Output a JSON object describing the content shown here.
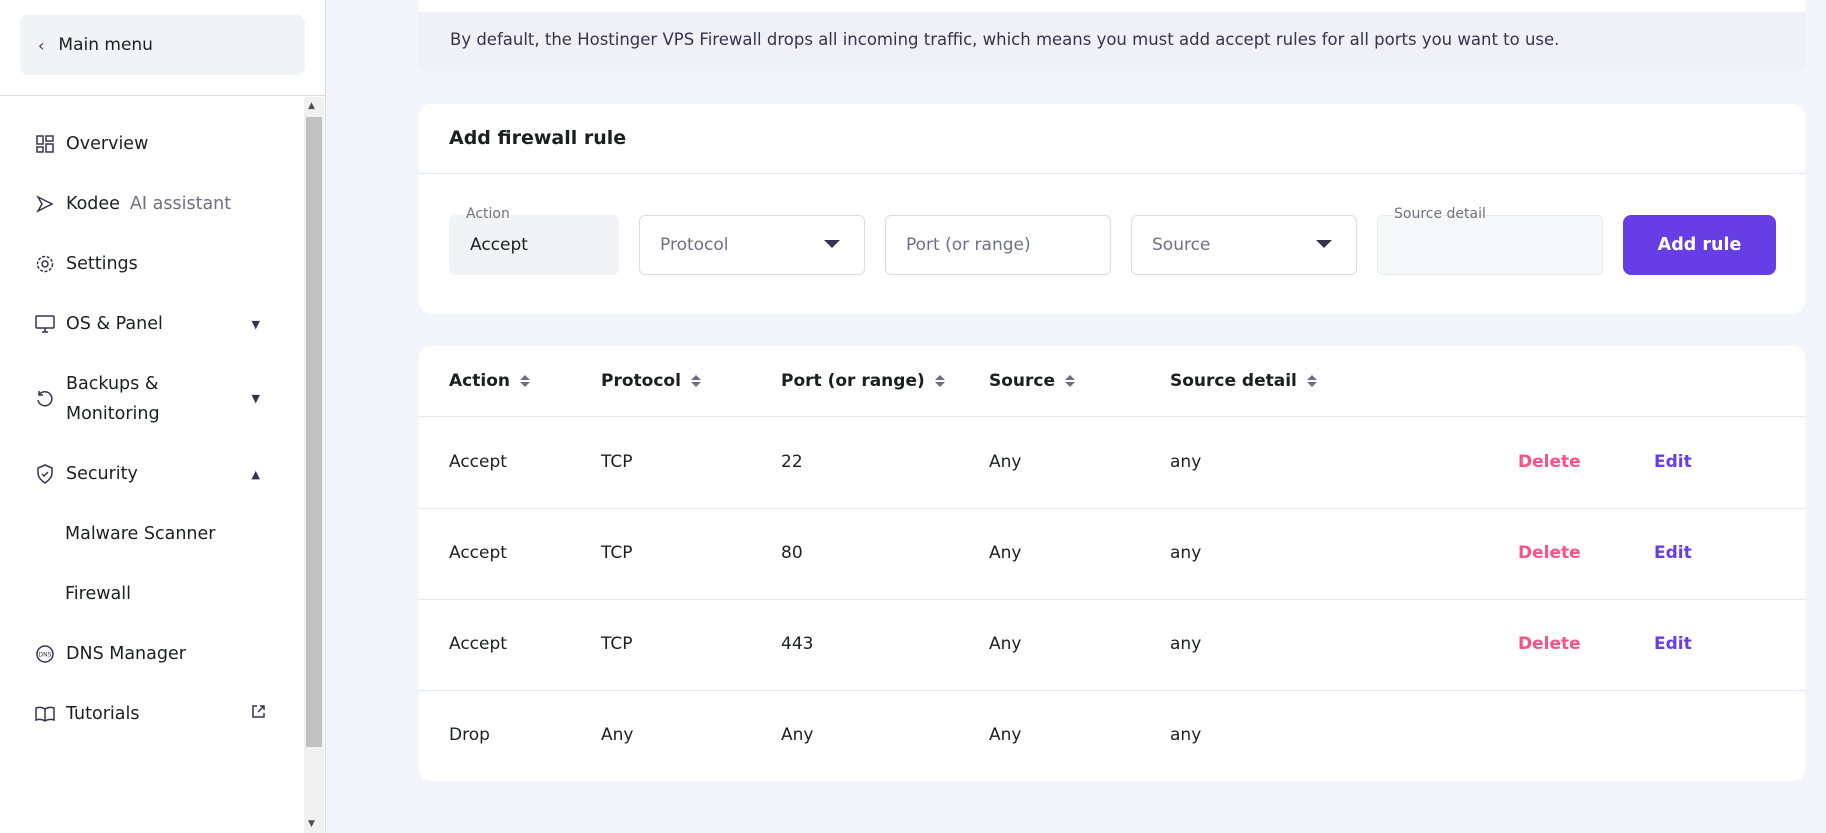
{
  "sidebar": {
    "main_menu": "Main menu",
    "items": [
      {
        "label": "Overview"
      },
      {
        "label": "Kodee",
        "sub": "AI assistant"
      },
      {
        "label": "Settings"
      },
      {
        "label": "OS & Panel"
      },
      {
        "label_line1": "Backups &",
        "label_line2": "Monitoring"
      },
      {
        "label": "Security"
      },
      {
        "label": "Malware Scanner"
      },
      {
        "label": "Firewall"
      },
      {
        "label": "DNS Manager"
      },
      {
        "label": "Tutorials"
      }
    ]
  },
  "info_text": "By default, the Hostinger VPS Firewall drops all incoming traffic, which means you must add accept rules for all ports you want to use.",
  "add_rule": {
    "title": "Add firewall rule",
    "action_label": "Action",
    "action_value": "Accept",
    "protocol_placeholder": "Protocol",
    "port_placeholder": "Port (or range)",
    "source_placeholder": "Source",
    "source_detail_label": "Source detail",
    "button": "Add rule"
  },
  "table": {
    "headers": [
      "Action",
      "Protocol",
      "Port (or range)",
      "Source",
      "Source detail"
    ],
    "delete_label": "Delete",
    "edit_label": "Edit",
    "rows": [
      {
        "action": "Accept",
        "protocol": "TCP",
        "port": "22",
        "source": "Any",
        "detail": "any"
      },
      {
        "action": "Accept",
        "protocol": "TCP",
        "port": "80",
        "source": "Any",
        "detail": "any"
      },
      {
        "action": "Accept",
        "protocol": "TCP",
        "port": "443",
        "source": "Any",
        "detail": "any"
      },
      {
        "action": "Drop",
        "protocol": "Any",
        "port": "Any",
        "source": "Any",
        "detail": "any"
      }
    ]
  },
  "colors": {
    "primary": "#673de6",
    "danger": "#fc5185"
  }
}
